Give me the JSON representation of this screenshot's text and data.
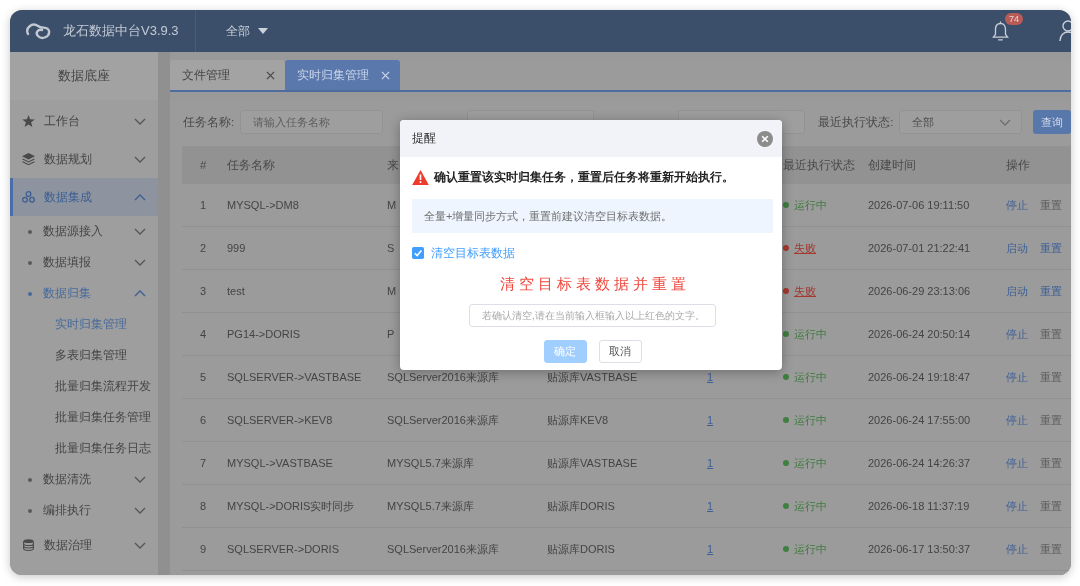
{
  "topbar": {
    "title": "龙石数据中台V3.9.3",
    "scope": "全部",
    "notification_count": "74"
  },
  "sidebar": {
    "title": "数据底座",
    "items": [
      {
        "label": "工作台",
        "selected": false,
        "expanded": false
      },
      {
        "label": "数据规划",
        "selected": false,
        "expanded": false
      },
      {
        "label": "数据集成",
        "selected": true,
        "expanded": true,
        "children": [
          {
            "label": "数据源接入",
            "selected": false,
            "expanded": false
          },
          {
            "label": "数据填报",
            "selected": false,
            "expanded": false
          },
          {
            "label": "数据归集",
            "selected": true,
            "expanded": true,
            "children": [
              {
                "label": "实时归集管理",
                "selected": true
              },
              {
                "label": "多表归集管理",
                "selected": false
              },
              {
                "label": "批量归集流程开发",
                "selected": false
              },
              {
                "label": "批量归集任务管理",
                "selected": false
              },
              {
                "label": "批量归集任务日志",
                "selected": false
              }
            ]
          },
          {
            "label": "数据清洗",
            "selected": false,
            "expanded": false
          },
          {
            "label": "编排执行",
            "selected": false,
            "expanded": false
          }
        ]
      },
      {
        "label": "数据治理",
        "selected": false,
        "expanded": false
      }
    ]
  },
  "tabs": [
    {
      "label": "文件管理",
      "selected": false
    },
    {
      "label": "实时归集管理",
      "selected": true
    }
  ],
  "filters": [
    {
      "kind": "text",
      "label": "任务名称:",
      "placeholder": "请输入任务名称"
    },
    {
      "kind": "text"
    },
    {
      "kind": "text"
    },
    {
      "kind": "select",
      "label": "最近执行状态:",
      "value": "全部"
    }
  ],
  "query_button": "查询",
  "table": {
    "header": {
      "index": "#",
      "name": "任务名称",
      "source": "来",
      "status": "最近执行状态",
      "created": "创建时间",
      "actions": "操作"
    },
    "rows": [
      {
        "index": "1",
        "name": "MYSQL->DM8",
        "source": "M",
        "status": {
          "kind": "running",
          "text": "运行中"
        },
        "created": "2026-07-06 19:11:50",
        "actions": [
          {
            "label": "停止",
            "disabled": false
          },
          {
            "label": "重置",
            "disabled": true
          }
        ]
      },
      {
        "index": "2",
        "name": "999",
        "source": "S",
        "status": {
          "kind": "failed",
          "text": "失败"
        },
        "created": "2026-07-01 21:22:41",
        "actions": [
          {
            "label": "启动",
            "disabled": false
          },
          {
            "label": "重置",
            "disabled": false
          }
        ]
      },
      {
        "index": "3",
        "name": "test",
        "source": "M",
        "status": {
          "kind": "failed",
          "text": "失败"
        },
        "created": "2026-06-29 23:13:06",
        "actions": [
          {
            "label": "启动",
            "disabled": false
          },
          {
            "label": "重置",
            "disabled": false
          }
        ]
      },
      {
        "index": "4",
        "name": "PG14->DORIS",
        "source": "P",
        "status": {
          "kind": "running",
          "text": "运行中"
        },
        "created": "2026-06-24 20:50:14",
        "actions": [
          {
            "label": "停止",
            "disabled": false
          },
          {
            "label": "重置",
            "disabled": true
          }
        ]
      },
      {
        "index": "5",
        "name": "SQLSERVER->VASTBASE",
        "source": "SQLServer2016来源库",
        "target": "贴源库VASTBASE",
        "count": "1",
        "status": {
          "kind": "running",
          "text": "运行中"
        },
        "created": "2026-06-24 19:18:47",
        "actions": [
          {
            "label": "停止",
            "disabled": false
          },
          {
            "label": "重置",
            "disabled": true
          }
        ]
      },
      {
        "index": "6",
        "name": "SQLSERVER->KEV8",
        "source": "SQLServer2016来源库",
        "target": "贴源库KEV8",
        "count": "1",
        "status": {
          "kind": "running",
          "text": "运行中"
        },
        "created": "2026-06-24 17:55:00",
        "actions": [
          {
            "label": "停止",
            "disabled": false
          },
          {
            "label": "重置",
            "disabled": true
          }
        ]
      },
      {
        "index": "7",
        "name": "MYSQL->VASTBASE",
        "source": "MYSQL5.7来源库",
        "target": "贴源库VASTBASE",
        "count": "1",
        "status": {
          "kind": "running",
          "text": "运行中"
        },
        "created": "2026-06-24 14:26:37",
        "actions": [
          {
            "label": "停止",
            "disabled": false
          },
          {
            "label": "重置",
            "disabled": true
          }
        ]
      },
      {
        "index": "8",
        "name": "MYSQL->DORIS实时同步",
        "source": "MYSQL5.7来源库",
        "target": "贴源库DORIS",
        "count": "1",
        "status": {
          "kind": "running",
          "text": "运行中"
        },
        "created": "2026-06-18 11:37:19",
        "actions": [
          {
            "label": "停止",
            "disabled": false
          },
          {
            "label": "重置",
            "disabled": true
          }
        ]
      },
      {
        "index": "9",
        "name": "SQLSERVER->DORIS",
        "source": "SQLServer2016来源库",
        "target": "贴源库DORIS",
        "count": "1",
        "status": {
          "kind": "running",
          "text": "运行中"
        },
        "created": "2026-06-17 13:50:37",
        "actions": [
          {
            "label": "停止",
            "disabled": false
          },
          {
            "label": "重置",
            "disabled": true
          }
        ]
      }
    ]
  },
  "dialog": {
    "title": "提醒",
    "message": "确认重置该实时归集任务，重置后任务将重新开始执行。",
    "note": "全量+增量同步方式，重置前建议清空目标表数据。",
    "option": {
      "label": "清空目标表数据",
      "checked": true
    },
    "confirm_phrase": "清空目标表数据并重置",
    "input": {
      "placeholder": "若确认清空,请在当前输入框输入以上红色的文字。"
    },
    "buttons": [
      {
        "label": "确定",
        "kind": "primary",
        "disabled": true
      },
      {
        "label": "取消",
        "kind": "default",
        "disabled": false
      }
    ]
  }
}
